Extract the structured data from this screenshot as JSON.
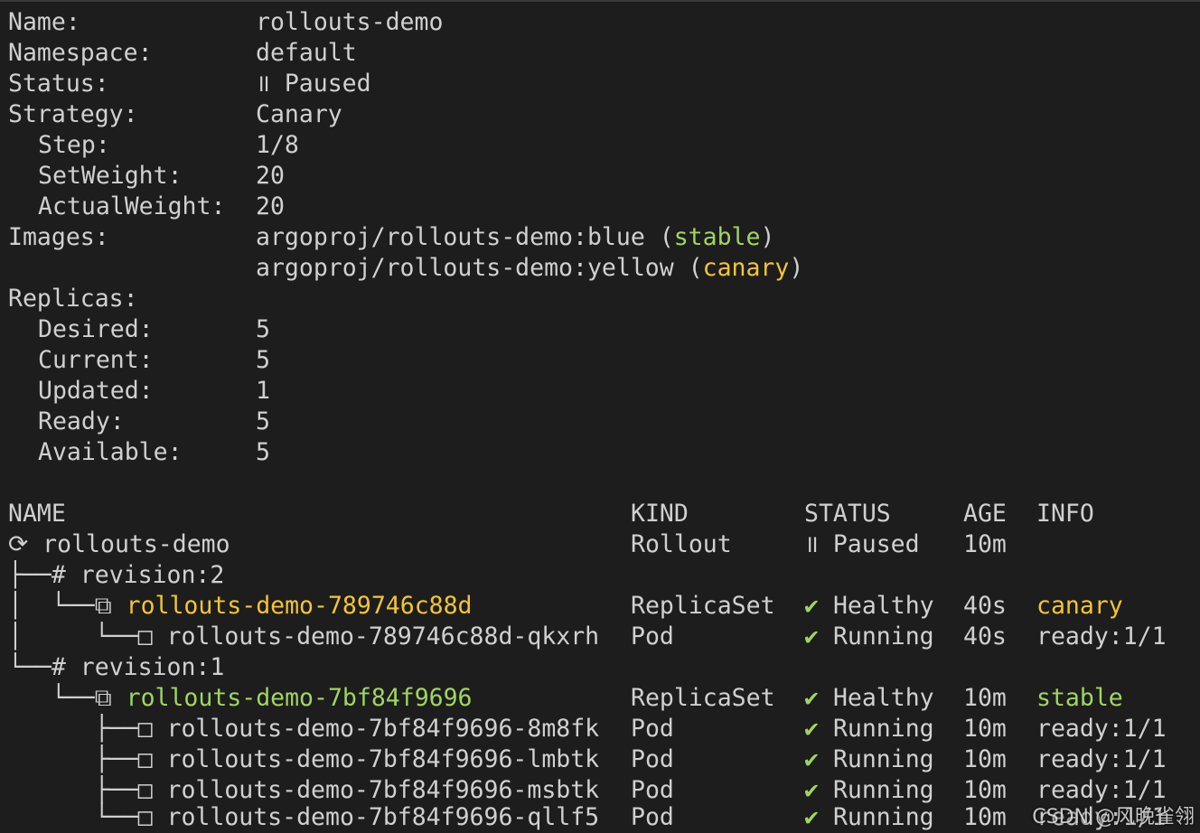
{
  "summary": {
    "name_label": "Name:",
    "name_value": "rollouts-demo",
    "namespace_label": "Namespace:",
    "namespace_value": "default",
    "status_label": "Status:",
    "status_icon": "॥",
    "status_value": "Paused",
    "strategy_label": "Strategy:",
    "strategy_value": "Canary",
    "step_label": "Step:",
    "step_value": "1/8",
    "setweight_label": "SetWeight:",
    "setweight_value": "20",
    "actualweight_label": "ActualWeight:",
    "actualweight_value": "20",
    "images_label": "Images:",
    "images": [
      {
        "ref": "argoproj/rollouts-demo:blue",
        "tag": "stable"
      },
      {
        "ref": "argoproj/rollouts-demo:yellow",
        "tag": "canary"
      }
    ],
    "replicas_label": "Replicas:",
    "desired_label": "Desired:",
    "desired_value": "5",
    "current_label": "Current:",
    "current_value": "5",
    "updated_label": "Updated:",
    "updated_value": "1",
    "ready_label": "Ready:",
    "ready_value": "5",
    "available_label": "Available:",
    "available_value": "5"
  },
  "tree": {
    "headers": {
      "name": "NAME",
      "kind": "KIND",
      "status": "STATUS",
      "age": "AGE",
      "info": "INFO"
    },
    "rows": [
      {
        "prefix": "⟳ ",
        "name": "rollouts-demo",
        "kind": "Rollout",
        "status_icon": "॥",
        "status": "Paused",
        "age": "10m",
        "info": "",
        "color": ""
      },
      {
        "prefix": "├──# ",
        "name": "revision:2",
        "kind": "",
        "status_icon": "",
        "status": "",
        "age": "",
        "info": "",
        "color": ""
      },
      {
        "prefix": "│  └──⧉ ",
        "name": "rollouts-demo-789746c88d",
        "kind": "ReplicaSet",
        "status_icon": "✔",
        "status": "Healthy",
        "age": "40s",
        "info": "canary",
        "color": "yellow"
      },
      {
        "prefix": "│     └──□ ",
        "name": "rollouts-demo-789746c88d-qkxrh",
        "kind": "Pod",
        "status_icon": "✔",
        "status": "Running",
        "age": "40s",
        "info": "ready:1/1",
        "color": ""
      },
      {
        "prefix": "└──# ",
        "name": "revision:1",
        "kind": "",
        "status_icon": "",
        "status": "",
        "age": "",
        "info": "",
        "color": ""
      },
      {
        "prefix": "   └──⧉ ",
        "name": "rollouts-demo-7bf84f9696",
        "kind": "ReplicaSet",
        "status_icon": "✔",
        "status": "Healthy",
        "age": "10m",
        "info": "stable",
        "color": "green"
      },
      {
        "prefix": "      ├──□ ",
        "name": "rollouts-demo-7bf84f9696-8m8fk",
        "kind": "Pod",
        "status_icon": "✔",
        "status": "Running",
        "age": "10m",
        "info": "ready:1/1",
        "color": ""
      },
      {
        "prefix": "      ├──□ ",
        "name": "rollouts-demo-7bf84f9696-lmbtk",
        "kind": "Pod",
        "status_icon": "✔",
        "status": "Running",
        "age": "10m",
        "info": "ready:1/1",
        "color": ""
      },
      {
        "prefix": "      ├──□ ",
        "name": "rollouts-demo-7bf84f9696-msbtk",
        "kind": "Pod",
        "status_icon": "✔",
        "status": "Running",
        "age": "10m",
        "info": "ready:1/1",
        "color": ""
      },
      {
        "prefix": "      └──□ ",
        "name": "rollouts-demo-7bf84f9696-qllf5",
        "kind": "Pod",
        "status_icon": "✔",
        "status": "Running",
        "age": "10m",
        "info": "ready:1/1",
        "color": ""
      }
    ]
  },
  "watermark": "CSDN @风晚雀翎",
  "colors": {
    "background": "#1d1d1d",
    "text": "#d0d0d0",
    "stable": "#9fd660",
    "canary": "#f4c531",
    "check": "#9fd660"
  }
}
